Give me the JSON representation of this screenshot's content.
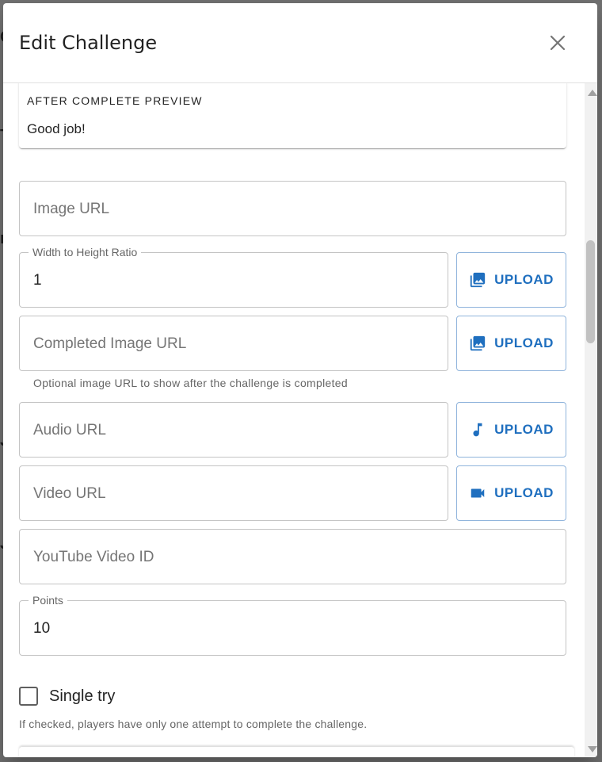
{
  "dialog": {
    "title": "Edit Challenge",
    "close_icon": "close-icon"
  },
  "preview": {
    "label": "AFTER COMPLETE PREVIEW",
    "text": "Good job!"
  },
  "fields": {
    "image_url": {
      "placeholder": "Image URL",
      "value": ""
    },
    "ratio": {
      "label": "Width to Height Ratio",
      "value": "1"
    },
    "completed_image_url": {
      "placeholder": "Completed Image URL",
      "value": "",
      "helper": "Optional image URL to show after the challenge is completed"
    },
    "audio_url": {
      "placeholder": "Audio URL",
      "value": ""
    },
    "video_url": {
      "placeholder": "Video URL",
      "value": ""
    },
    "youtube_id": {
      "placeholder": "YouTube Video ID",
      "value": ""
    },
    "points": {
      "label": "Points",
      "value": "10"
    }
  },
  "upload": {
    "label": "UPLOAD",
    "image_icon": "image-icon",
    "audio_icon": "music-note-icon",
    "video_icon": "videocam-icon"
  },
  "single_try": {
    "label": "Single try",
    "checked": false,
    "helper": "If checked, players have only one attempt to complete the challenge."
  },
  "colors": {
    "primary": "#1f6fbf",
    "outline": "#c4c4c4",
    "upload_outline": "#90b4dc"
  }
}
